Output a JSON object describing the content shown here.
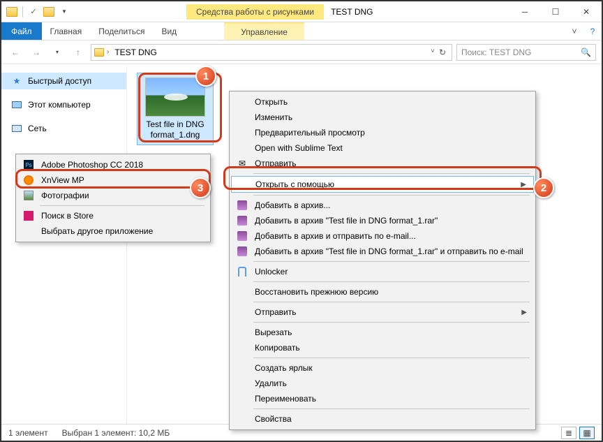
{
  "title": "TEST DNG",
  "context_tab": "Средства работы с рисунками",
  "context_sub": "Управление",
  "ribbon": {
    "file": "Файл",
    "home": "Главная",
    "share": "Поделиться",
    "view": "Вид"
  },
  "breadcrumb": {
    "folder": "TEST DNG"
  },
  "search": {
    "placeholder": "Поиск: TEST DNG"
  },
  "sidebar": {
    "quick": "Быстрый доступ",
    "pc": "Этот компьютер",
    "net": "Сеть"
  },
  "file": {
    "name": "Test file in DNG format_1.dng"
  },
  "context_menu": {
    "open": "Открыть",
    "edit": "Изменить",
    "preview": "Предварительный просмотр",
    "sublime": "Open with Sublime Text",
    "send_cut": "Отправить",
    "open_with": "Открыть с помощью",
    "add_archive": "Добавить в архив...",
    "add_rar": "Добавить в архив \"Test file in DNG format_1.rar\"",
    "add_email": "Добавить в архив и отправить по e-mail...",
    "add_rar_email": "Добавить в архив \"Test file in DNG format_1.rar\" и отправить по e-mail",
    "unlocker": "Unlocker",
    "restore": "Восстановить прежнюю версию",
    "send_to": "Отправить",
    "cut": "Вырезать",
    "copy": "Копировать",
    "shortcut": "Создать ярлык",
    "delete": "Удалить",
    "rename": "Переименовать",
    "properties": "Свойства"
  },
  "submenu": {
    "photoshop": "Adobe Photoshop CC 2018",
    "xnview": "XnView MP",
    "photos": "Фотографии",
    "store": "Поиск в Store",
    "other": "Выбрать другое приложение"
  },
  "status": {
    "count": "1 элемент",
    "selected": "Выбран 1 элемент: 10,2 МБ"
  },
  "callouts": {
    "c1": "1",
    "c2": "2",
    "c3": "3"
  }
}
